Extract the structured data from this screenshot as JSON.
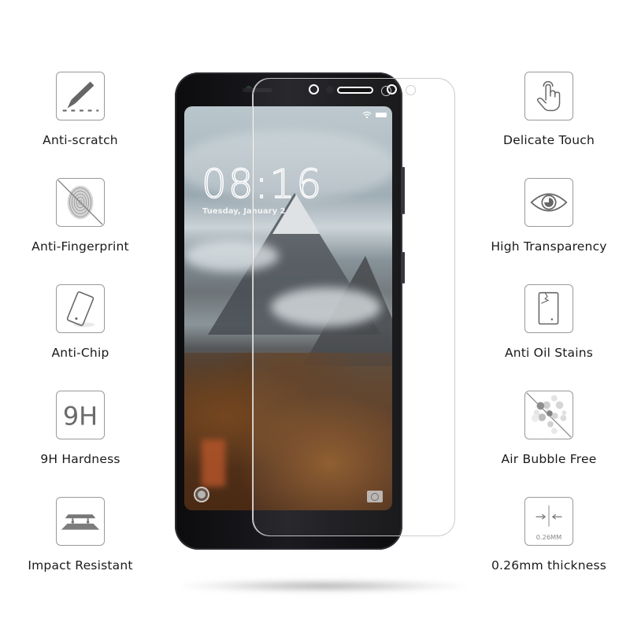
{
  "features_left": [
    {
      "label": "Anti-scratch",
      "icon": "scalpel-icon"
    },
    {
      "label": "Anti-Fingerprint",
      "icon": "fingerprint-icon"
    },
    {
      "label": "Anti-Chip",
      "icon": "tilted-phone-icon"
    },
    {
      "label": "9H Hardness",
      "icon": "9h-icon",
      "icon_text": "9H"
    },
    {
      "label": "Impact Resistant",
      "icon": "layers-icon"
    }
  ],
  "features_right": [
    {
      "label": "Delicate Touch",
      "icon": "touch-hand-icon"
    },
    {
      "label": "High Transparency",
      "icon": "eye-icon"
    },
    {
      "label": "Anti Oil Stains",
      "icon": "cracked-phone-icon"
    },
    {
      "label": "Air Bubble Free",
      "icon": "bubbles-icon"
    },
    {
      "label": "0.26mm thickness",
      "icon": "thickness-icon",
      "icon_text": "0.26MM"
    }
  ],
  "phone": {
    "lock_time": "08:16",
    "lock_date": "Tuesday, January 2"
  },
  "colors": {
    "icon_gray": "#6b6b6b",
    "icon_border": "#9a9a9a",
    "label_text": "#1a1a1a",
    "phone_body": "#111114"
  }
}
